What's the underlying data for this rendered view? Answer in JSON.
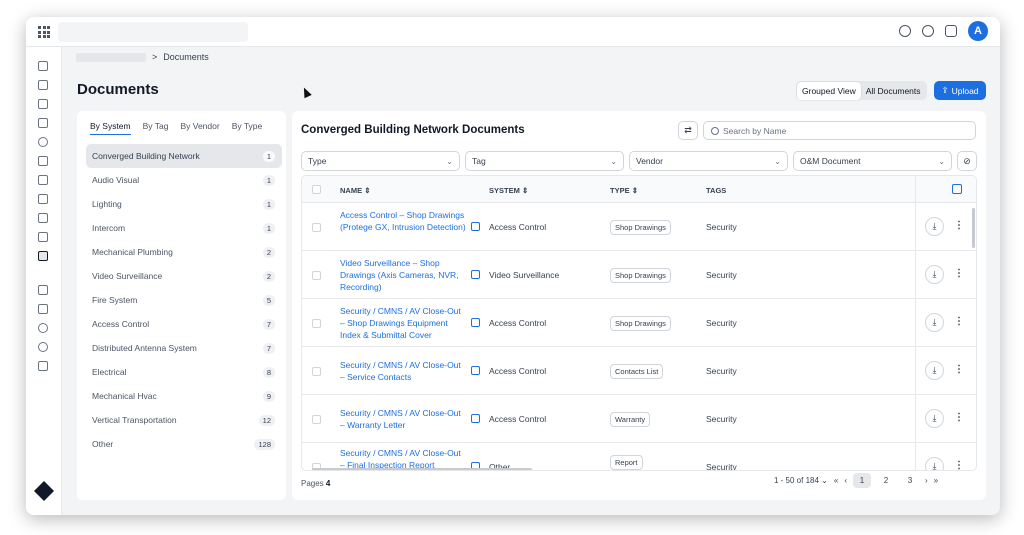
{
  "breadcrumb": {
    "current": "Documents"
  },
  "page": {
    "title": "Documents"
  },
  "header": {
    "avatar_initial": "A"
  },
  "view_toggle": {
    "grouped": "Grouped View",
    "all": "All Documents"
  },
  "upload": {
    "label": "Upload"
  },
  "left_panel": {
    "tabs": [
      "By System",
      "By Tag",
      "By Vendor",
      "By Type"
    ],
    "items": [
      {
        "name": "Converged Building Network",
        "count": "1"
      },
      {
        "name": "Audio Visual",
        "count": "1"
      },
      {
        "name": "Lighting",
        "count": "1"
      },
      {
        "name": "Intercom",
        "count": "1"
      },
      {
        "name": "Mechanical Plumbing",
        "count": "2"
      },
      {
        "name": "Video Surveillance",
        "count": "2"
      },
      {
        "name": "Fire System",
        "count": "5"
      },
      {
        "name": "Access Control",
        "count": "7"
      },
      {
        "name": "Distributed Antenna System",
        "count": "7"
      },
      {
        "name": "Electrical",
        "count": "8"
      },
      {
        "name": "Mechanical Hvac",
        "count": "9"
      },
      {
        "name": "Vertical Transportation",
        "count": "12"
      },
      {
        "name": "Other",
        "count": "128"
      }
    ]
  },
  "main": {
    "title": "Converged Building Network Documents",
    "search_placeholder": "Search by Name",
    "filters": {
      "type": "Type",
      "tag": "Tag",
      "vendor": "Vendor",
      "om": "O&M Document"
    },
    "columns": {
      "name": "NAME",
      "system": "SYSTEM",
      "type": "TYPE",
      "tags": "TAGS"
    },
    "rows": [
      {
        "name": "Access Control – Shop Drawings (Protege GX, Intrusion Detection)",
        "system": "Access Control",
        "type": "Shop Drawings",
        "tags": "Security"
      },
      {
        "name": "Video Surveillance – Shop Drawings (Axis Cameras, NVR, Recording)",
        "system": "Video Surveillance",
        "type": "Shop Drawings",
        "tags": "Security"
      },
      {
        "name": "Security / CMNS / AV Close-Out – Shop Drawings Equipment Index & Submittal Cover",
        "system": "Access Control",
        "type": "Shop Drawings",
        "tags": "Security"
      },
      {
        "name": "Security / CMNS / AV Close-Out – Service Contacts",
        "system": "Access Control",
        "type": "Contacts List",
        "tags": "Security"
      },
      {
        "name": "Security / CMNS / AV Close-Out – Warranty Letter",
        "system": "Access Control",
        "type": "Warranty",
        "tags": "Security"
      },
      {
        "name": "Security / CMNS / AV Close-Out – Final Inspection Report",
        "system": "Other",
        "type": "Report",
        "tags": "Security"
      }
    ],
    "pages_label": "Pages",
    "pages_count": "4",
    "range": "1 - 50 of 184",
    "page_numbers": [
      "1",
      "2",
      "3"
    ]
  }
}
